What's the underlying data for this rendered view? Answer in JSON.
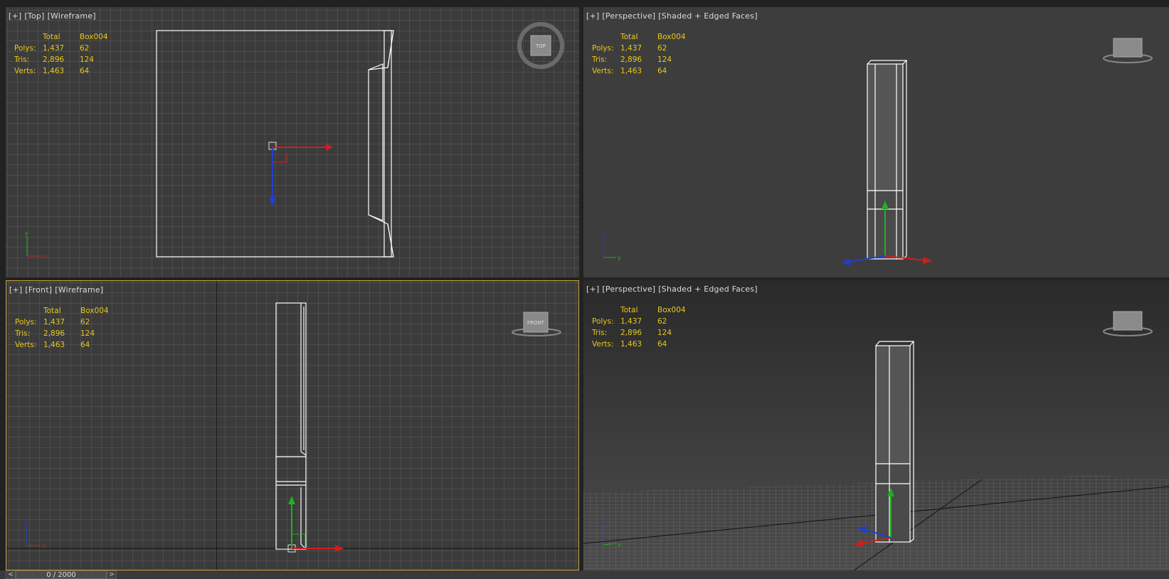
{
  "viewports": [
    {
      "id": "top",
      "label": [
        "[+]",
        "[Top]",
        "[Wireframe]"
      ],
      "stats": {
        "headers": [
          "",
          "Total",
          "Box004"
        ],
        "rows": [
          [
            "Polys:",
            "1,437",
            "62"
          ],
          [
            "Tris:",
            "2,896",
            "124"
          ],
          [
            "Verts:",
            "1,463",
            "64"
          ]
        ]
      },
      "cube_label": "TOP"
    },
    {
      "id": "persp1",
      "label": [
        "[+]",
        "[Perspective]",
        "[Shaded + Edged Faces]"
      ],
      "stats": {
        "headers": [
          "",
          "Total",
          "Box004"
        ],
        "rows": [
          [
            "Polys:",
            "1,437",
            "62"
          ],
          [
            "Tris:",
            "2,896",
            "124"
          ],
          [
            "Verts:",
            "1,463",
            "64"
          ]
        ]
      }
    },
    {
      "id": "front",
      "label": [
        "[+]",
        "[Front]",
        "[Wireframe]"
      ],
      "stats": {
        "headers": [
          "",
          "Total",
          "Box004"
        ],
        "rows": [
          [
            "Polys:",
            "1,437",
            "62"
          ],
          [
            "Tris:",
            "2,896",
            "124"
          ],
          [
            "Verts:",
            "1,463",
            "64"
          ]
        ]
      },
      "cube_label": "FRONT"
    },
    {
      "id": "persp2",
      "label": [
        "[+]",
        "[Perspective]",
        "[Shaded + Edged Faces]"
      ],
      "stats": {
        "headers": [
          "",
          "Total",
          "Box004"
        ],
        "rows": [
          [
            "Polys:",
            "1,437",
            "62"
          ],
          [
            "Tris:",
            "2,896",
            "124"
          ],
          [
            "Verts:",
            "1,463",
            "64"
          ]
        ]
      }
    }
  ],
  "timeline": {
    "frame": "0 / 2000",
    "prev": "<",
    "next": ">"
  },
  "colors": {
    "active_border": "#c8a040",
    "stats_text": "#e8c81a",
    "label_text": "#dcdcdc",
    "axis_x": "#cc2020",
    "axis_y": "#20b020",
    "axis_z": "#2040cc"
  }
}
